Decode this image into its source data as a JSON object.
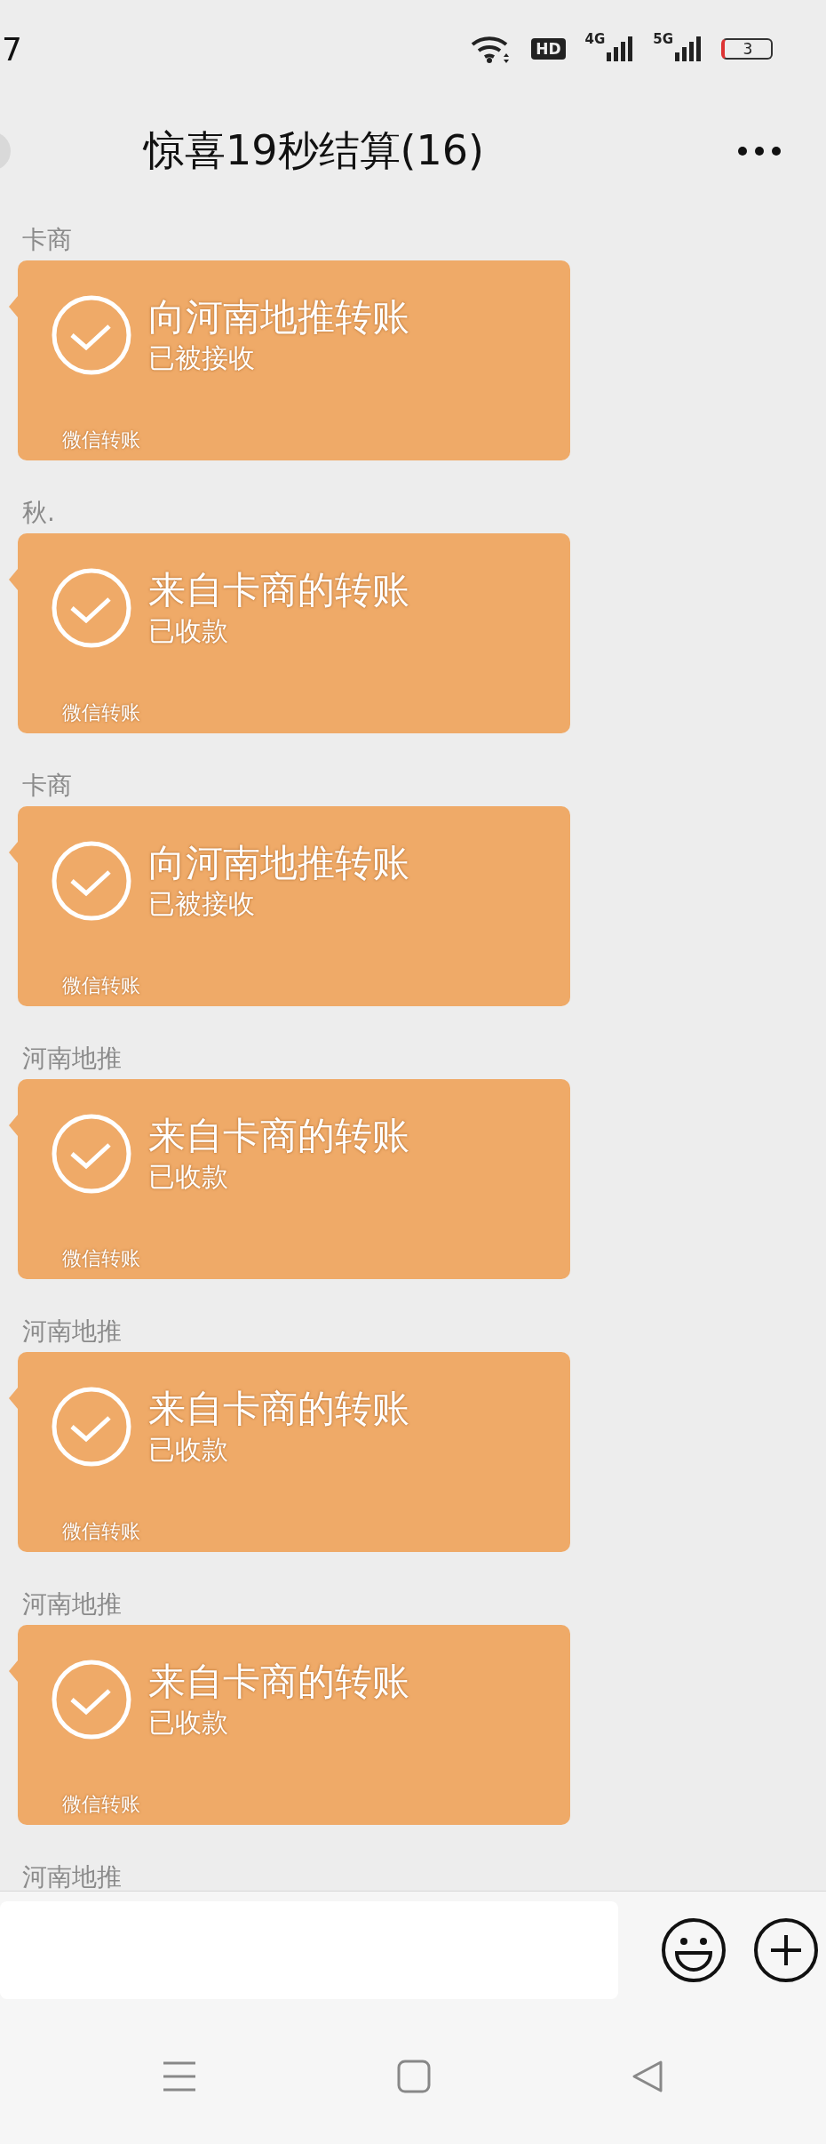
{
  "status_bar": {
    "time": "7",
    "hd_label": "HD",
    "networks": [
      {
        "label": "4G"
      },
      {
        "label": "5G"
      }
    ],
    "battery": "3"
  },
  "header": {
    "title": "惊喜19秒结算(16)"
  },
  "messages": [
    {
      "sender": "卡商",
      "title": "向河南地推转账",
      "status": "已被接收",
      "footer": "微信转账"
    },
    {
      "sender": "秋.",
      "title": "来自卡商的转账",
      "status": "已收款",
      "footer": "微信转账"
    },
    {
      "sender": "卡商",
      "title": "向河南地推转账",
      "status": "已被接收",
      "footer": "微信转账"
    },
    {
      "sender": "河南地推",
      "title": "来自卡商的转账",
      "status": "已收款",
      "footer": "微信转账"
    },
    {
      "sender": "河南地推",
      "title": "来自卡商的转账",
      "status": "已收款",
      "footer": "微信转账"
    },
    {
      "sender": "河南地推",
      "title": "来自卡商的转账",
      "status": "已收款",
      "footer": "微信转账"
    },
    {
      "sender": "河南地推"
    }
  ]
}
